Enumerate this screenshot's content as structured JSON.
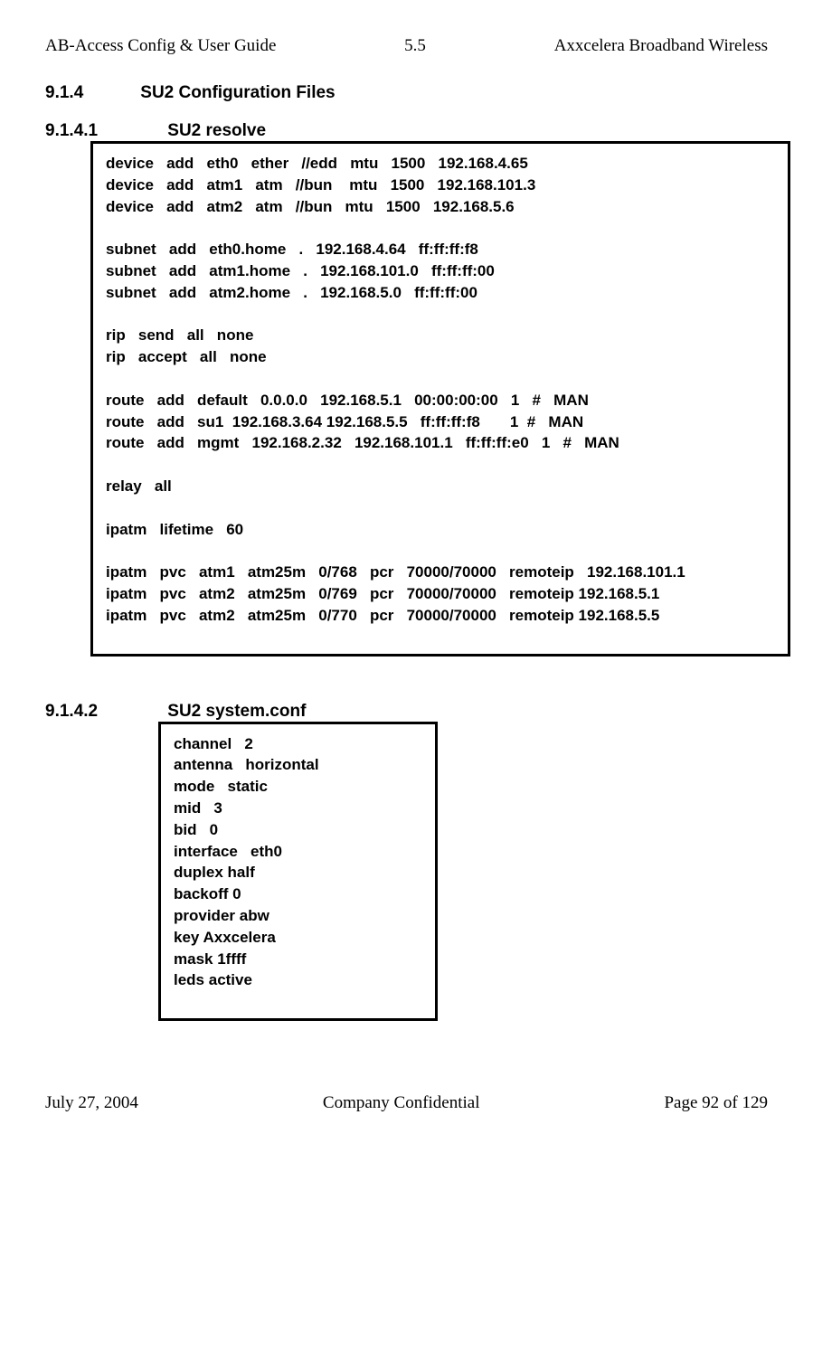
{
  "header": {
    "left": "AB-Access Config & User Guide",
    "center": "5.5",
    "right": "Axxcelera Broadband Wireless"
  },
  "section914": {
    "number": "9.1.4",
    "title": "SU2 Configuration Files"
  },
  "section9141": {
    "number": "9.1.4.1",
    "title": "SU2 resolve",
    "content": "device   add   eth0   ether   //edd   mtu   1500   192.168.4.65\ndevice   add   atm1   atm   //bun    mtu   1500   192.168.101.3\ndevice   add   atm2   atm   //bun   mtu   1500   192.168.5.6\n\nsubnet   add   eth0.home   .   192.168.4.64   ff:ff:ff:f8\nsubnet   add   atm1.home   .   192.168.101.0   ff:ff:ff:00\nsubnet   add   atm2.home   .   192.168.5.0   ff:ff:ff:00\n\nrip   send   all   none\nrip   accept   all   none\n\nroute   add   default   0.0.0.0   192.168.5.1   00:00:00:00   1   #   MAN\nroute   add   su1  192.168.3.64 192.168.5.5   ff:ff:ff:f8       1  #   MAN\nroute   add   mgmt   192.168.2.32   192.168.101.1   ff:ff:ff:e0   1   #   MAN\n\nrelay   all\n\nipatm   lifetime   60\n\nipatm   pvc   atm1   atm25m   0/768   pcr   70000/70000   remoteip   192.168.101.1\nipatm   pvc   atm2   atm25m   0/769   pcr   70000/70000   remoteip 192.168.5.1\nipatm   pvc   atm2   atm25m   0/770   pcr   70000/70000   remoteip 192.168.5.5"
  },
  "section9142": {
    "number": "9.1.4.2",
    "title": "SU2 system.conf",
    "content": "channel   2\nantenna   horizontal\nmode   static\nmid   3\nbid   0\ninterface   eth0\nduplex half\nbackoff 0\nprovider abw\nkey Axxcelera\nmask 1ffff\nleds active"
  },
  "footer": {
    "left": "July 27, 2004",
    "center": "Company Confidential",
    "right": "Page 92 of 129"
  }
}
